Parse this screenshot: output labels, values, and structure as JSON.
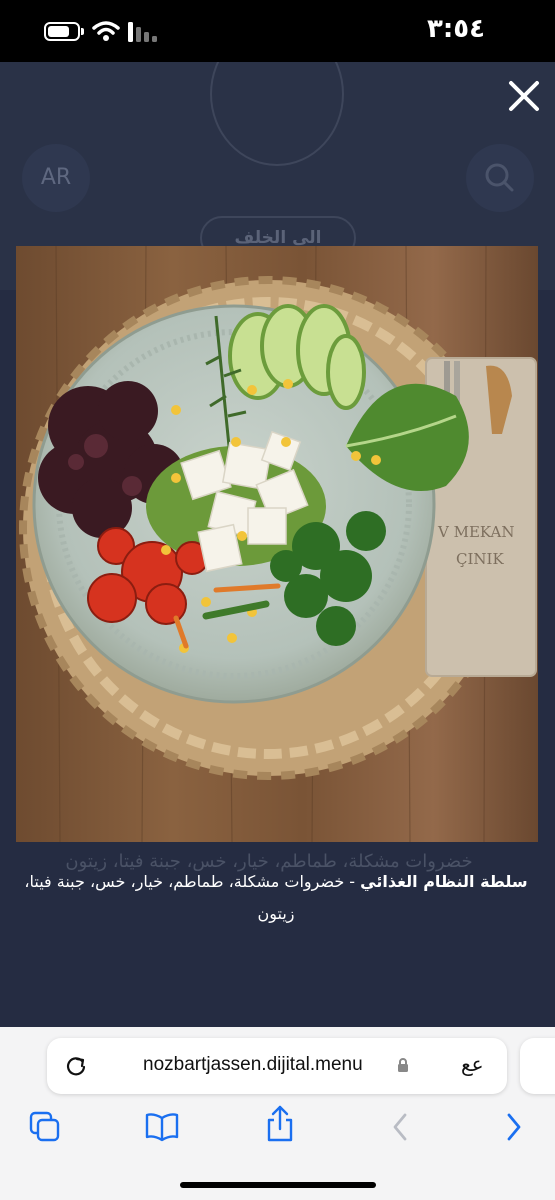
{
  "status_bar": {
    "time": "٣:٥٤",
    "battery_level": 0.75
  },
  "background_page": {
    "language_label": "AR",
    "back_button_label": "الى الخلف"
  },
  "item": {
    "name": "سلطة النظام الغذائي",
    "separator": " - ",
    "description": "خضروات مشكلة، طماطم، خيار، خس، جبنة فيتا، زيتون",
    "ghost_text": "خضروات مشكلة، طماطم، خيار، خس، جبنة فيتا، زيتون",
    "photo_napkin_text_1": "V MEKAN",
    "photo_napkin_text_2": "ÇINIK"
  },
  "browser": {
    "url": "nozbartjassen.dijital.menu",
    "reader_label": "عع"
  },
  "icons": {
    "close": "close-icon",
    "reload": "reload-icon",
    "lock": "lock-icon",
    "tabs": "tabs-icon",
    "bookmarks": "book-icon",
    "share": "share-icon",
    "back": "chevron-left-icon",
    "forward": "chevron-right-icon"
  }
}
